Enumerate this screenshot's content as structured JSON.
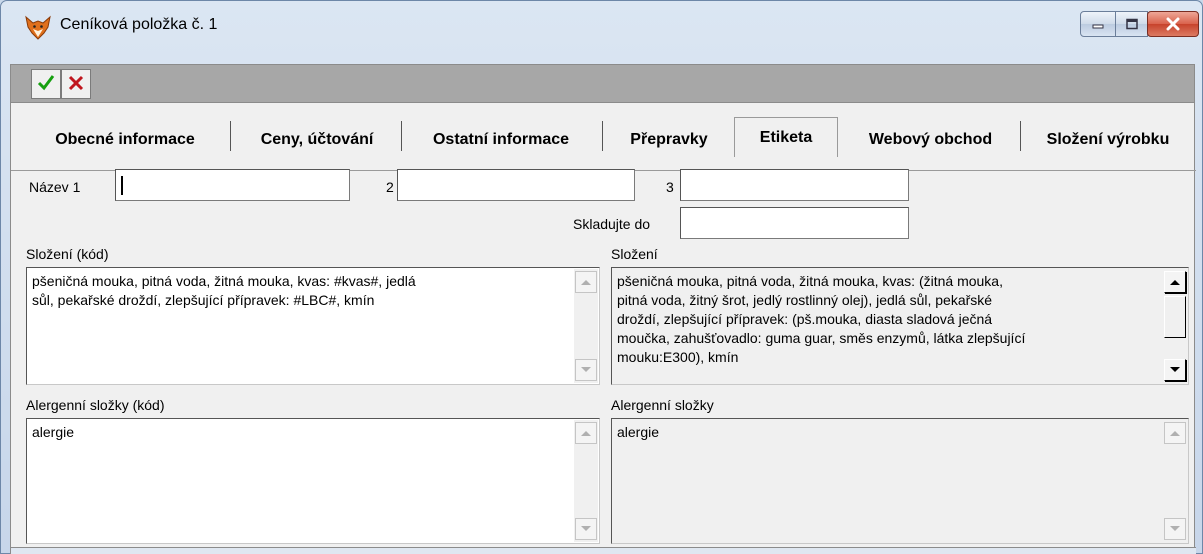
{
  "window": {
    "title": "Ceníková položka č. 1",
    "icon": "fox-icon"
  },
  "toolbar": {
    "ok_icon": "checkmark-icon",
    "cancel_icon": "x-icon",
    "ok_color": "#16a010",
    "cancel_color": "#c0161e"
  },
  "tabs": [
    {
      "label": "Obecné informace",
      "active": false
    },
    {
      "label": "Ceny, účtování",
      "active": false
    },
    {
      "label": "Ostatní informace",
      "active": false
    },
    {
      "label": "Přepravky",
      "active": false
    },
    {
      "label": "Etiketa",
      "active": true
    },
    {
      "label": "Webový obchod",
      "active": false
    },
    {
      "label": "Složení výrobku",
      "active": false
    }
  ],
  "form": {
    "nazev1_label": "Název 1",
    "nazev1_value": "",
    "nazev2_label": "2",
    "nazev2_value": "",
    "nazev3_label": "3",
    "nazev3_value": "",
    "skladujte_label": "Skladujte do",
    "skladujte_value": "",
    "slozeni_kod_label": "Složení (kód)",
    "slozeni_kod_value": "pšeničná mouka, pitná voda, žitná mouka, kvas: #kvas#, jedlá\nsůl, pekařské droždí, zlepšující přípravek: #LBC#, kmín",
    "slozeni_label": "Složení",
    "slozeni_value": "pšeničná mouka, pitná voda, žitná mouka, kvas: (žitná mouka,\npitná voda, žitný šrot, jedlý rostlinný olej), jedlá sůl, pekařské\ndroždí, zlepšující přípravek: (pš.mouka, diasta sladová ječná\nmoučka, zahušťovadlo: guma guar, směs enzymů, látka zlepšující\nmouku:E300), kmín",
    "alergeny_kod_label": "Alergenní složky (kód)",
    "alergeny_kod_value": "alergie",
    "alergeny_label": "Alergenní složky",
    "alergeny_value": "alergie"
  }
}
